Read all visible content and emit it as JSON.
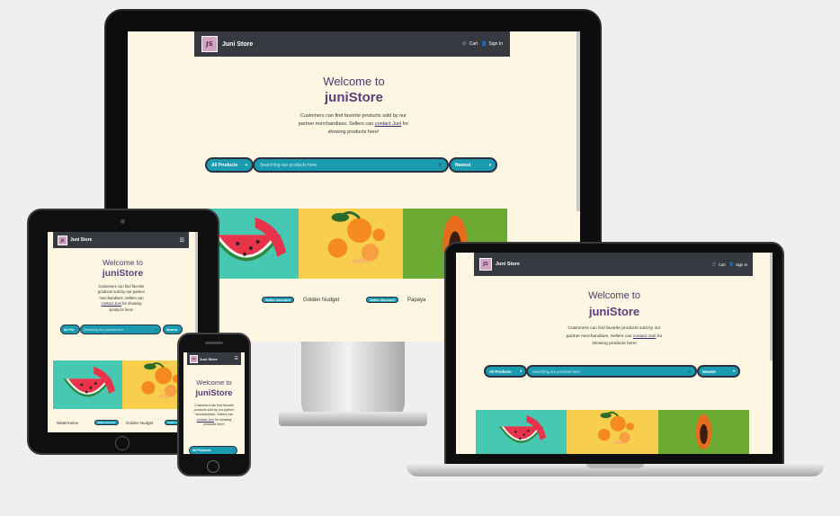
{
  "site": {
    "brand": "Juni Store",
    "logo_text": "JS",
    "nav": {
      "cart": "Cart",
      "sign_in": "Sign In",
      "menu_icon": "hamburger-icon"
    },
    "welcome": "Welcome to",
    "store_name": "juniStore",
    "description_pre": "Customers can find favorite products sold by our partner merchandises. Sellers can",
    "contact_link": "contact Juni",
    "description_post": "for showing products here!",
    "search": {
      "category_label": "All Products",
      "category_short": "All Pro",
      "placeholder": "Searching our products here",
      "sort_label": "Newest"
    },
    "products": [
      {
        "name": "Watermelon",
        "short_name": "elon",
        "button": "Seller Account"
      },
      {
        "name": "Golden Nudget",
        "button": "Seller Account"
      },
      {
        "name": "Papaya"
      }
    ]
  },
  "colors": {
    "page_bg": "#efefef",
    "screen_bg": "#fdf6e3",
    "nav_bg": "#363a40",
    "accent": "#1a9bb0",
    "title": "#4b3a6b",
    "watermelon_bg": "#47c8b2",
    "orange_bg": "#f7cf4c",
    "papaya_bg": "#6cab33"
  }
}
